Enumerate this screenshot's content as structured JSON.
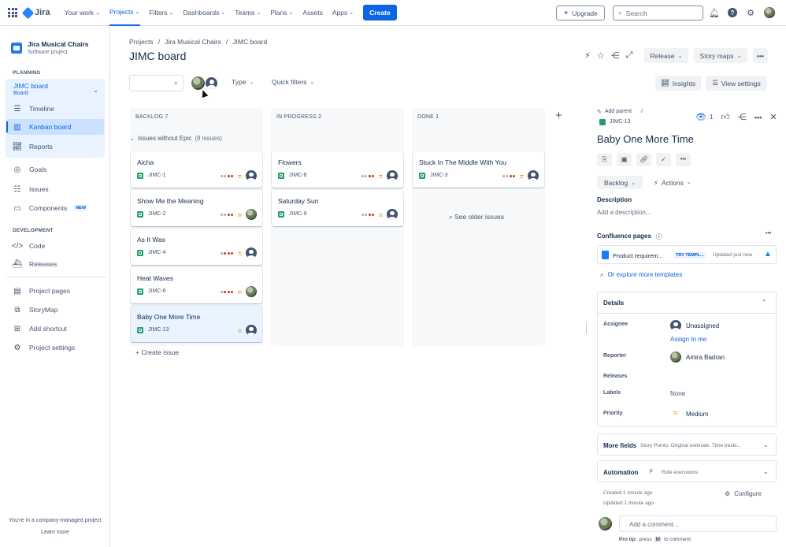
{
  "topnav": {
    "logo": "Jira",
    "items": [
      "Your work",
      "Projects",
      "Filters",
      "Dashboards",
      "Teams",
      "Plans",
      "Assets",
      "Apps"
    ],
    "create": "Create",
    "upgrade": "Upgrade",
    "search_placeholder": "Search"
  },
  "sidebar": {
    "project_name": "Jira Musical Chairs",
    "project_type": "Software project",
    "planning_label": "PLANNING",
    "board_name": "JIMC board",
    "board_type": "Board",
    "planning_items": [
      "Timeline",
      "Kanban board",
      "Reports"
    ],
    "general_items": [
      "Goals",
      "Issues",
      "Components"
    ],
    "new_badge": "NEW",
    "development_label": "DEVELOPMENT",
    "dev_items": [
      "Code",
      "Releases"
    ],
    "other_items": [
      "Project pages",
      "StoryMap",
      "Add shortcut",
      "Project settings"
    ],
    "footer": "You're in a company-managed project",
    "learn_more": "Learn more"
  },
  "main": {
    "breadcrumb": [
      "Projects",
      "/",
      "Jira Musical Chairs",
      "/",
      "JIMC board"
    ],
    "title": "JIMC board",
    "release": "Release",
    "story_maps": "Story maps",
    "type_filter": "Type",
    "quick_filters": "Quick filters",
    "insights": "Insights",
    "view_settings": "View settings",
    "swimlane": "Issues without Epic",
    "swimlane_count": "(8 issues)",
    "create_issue": "+ Create issue",
    "see_older": "See older issues"
  },
  "columns": [
    {
      "title": "BACKLOG 7",
      "cards": [
        {
          "title": "Aicha",
          "key": "JIMC-1",
          "avatar": "empty"
        },
        {
          "title": "Show Me the Meaning",
          "key": "JIMC-2",
          "avatar": "photo"
        },
        {
          "title": "As It Was",
          "key": "JIMC-4",
          "avatar": "empty"
        },
        {
          "title": "Heat Waves",
          "key": "JIMC-6",
          "avatar": "photo"
        },
        {
          "title": "Baby One More Time",
          "key": "JIMC-13",
          "avatar": "empty"
        }
      ]
    },
    {
      "title": "IN PROGRESS 2",
      "cards": [
        {
          "title": "Flowers",
          "key": "JIMC-8",
          "avatar": "empty"
        },
        {
          "title": "Saturday Sun",
          "key": "JIMC-9",
          "avatar": "empty"
        }
      ]
    },
    {
      "title": "DONE 1",
      "cards": [
        {
          "title": "Stuck In The Middle With You",
          "key": "JIMC-3",
          "avatar": "empty"
        }
      ]
    }
  ],
  "detail": {
    "add_parent": "Add parent",
    "slash": "/",
    "key": "JIMC-13",
    "watch_count": "1",
    "title": "Baby One More Time",
    "status": "Backlog",
    "actions": "Actions",
    "description_label": "Description",
    "description_placeholder": "Add a description...",
    "confluence_label": "Confluence pages",
    "confluence_doc": "Product requirem...",
    "try_template": "TRY TEMPL...",
    "updated": "Updated just now",
    "explore": "Or explore more templates",
    "details_label": "Details",
    "assignee_label": "Assignee",
    "assignee": "Unassigned",
    "assign_to_me": "Assign to me",
    "reporter_label": "Reporter",
    "reporter": "Amira Badran",
    "releases_label": "Releases",
    "labels_label": "Labels",
    "labels": "None",
    "priority_label": "Priority",
    "priority": "Medium",
    "more_fields": "More fields",
    "more_fields_hint": "Story Points, Original estimate, Time tracki...",
    "automation": "Automation",
    "rule_exec": "Rule executions",
    "created": "Created 1 minute ago",
    "updated_ago": "Updated 1 minute ago",
    "configure": "Configure",
    "comment_placeholder": "Add a comment...",
    "pro_tip_a": "Pro tip:",
    "pro_tip_b": "press",
    "pro_tip_key": "M",
    "pro_tip_c": "to comment"
  },
  "colors": {
    "accent": "#0c66e4",
    "story_green": "#22a06b",
    "priority_medium": "#e2a50b"
  }
}
